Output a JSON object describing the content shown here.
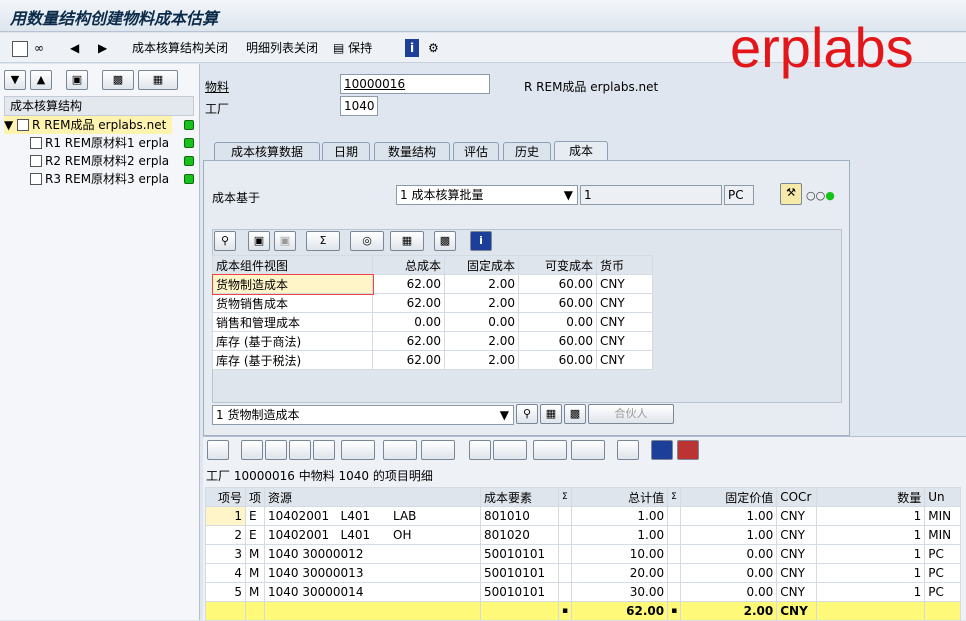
{
  "window": {
    "title": "用数量结构创建物料成本估算"
  },
  "brand": "erplabs",
  "toolbar": {
    "close_struct": "成本核算结构关闭",
    "close_detail": "明细列表关闭",
    "keep": "保持"
  },
  "tree": {
    "header": "成本核算结构",
    "items": [
      {
        "label": "R REM成品 erplabs.net"
      },
      {
        "label": "R1 REM原材料1 erpla"
      },
      {
        "label": "R2 REM原材料2 erpla"
      },
      {
        "label": "R3 REM原材料3 erpla"
      }
    ]
  },
  "header": {
    "material_label": "物料",
    "material_value": "10000016",
    "material_desc": "R REM成品 erplabs.net",
    "plant_label": "工厂",
    "plant_value": "1040"
  },
  "tabs": [
    "成本核算数据",
    "日期",
    "数量结构",
    "评估",
    "历史",
    "成本"
  ],
  "cost": {
    "basis_label": "成本基于",
    "basis_select": "1 成本核算批量",
    "qty": "1",
    "unit": "PC",
    "columns": [
      "成本组件视图",
      "总成本",
      "固定成本",
      "可变成本",
      "货币"
    ],
    "rows": [
      [
        "货物制造成本",
        "62.00",
        "2.00",
        "60.00",
        "CNY"
      ],
      [
        "货物销售成本",
        "62.00",
        "2.00",
        "60.00",
        "CNY"
      ],
      [
        "销售和管理成本",
        "0.00",
        "0.00",
        "0.00",
        "CNY"
      ],
      [
        "库存 (基于商法)",
        "62.00",
        "2.00",
        "60.00",
        "CNY"
      ],
      [
        "库存 (基于税法)",
        "62.00",
        "2.00",
        "60.00",
        "CNY"
      ]
    ],
    "view_select": "1 货物制造成本",
    "partner_btn": "合伙人"
  },
  "items": {
    "title": "工厂 10000016 中物料 1040 的项目明细",
    "columns": [
      "项号",
      "项",
      "资源",
      "成本要素",
      "Σ",
      "总计值",
      "Σ",
      "固定价值",
      "COCr",
      "数量",
      "Un"
    ],
    "rows": [
      [
        "1",
        "E",
        "10402001   L401      LAB",
        "801010",
        "",
        "1.00",
        "",
        "1.00",
        "CNY",
        "1",
        "MIN"
      ],
      [
        "2",
        "E",
        "10402001   L401      OH",
        "801020",
        "",
        "1.00",
        "",
        "1.00",
        "CNY",
        "1",
        "MIN"
      ],
      [
        "3",
        "M",
        "1040 30000012",
        "50010101",
        "",
        "10.00",
        "",
        "0.00",
        "CNY",
        "1",
        "PC"
      ],
      [
        "4",
        "M",
        "1040 30000013",
        "50010101",
        "",
        "20.00",
        "",
        "0.00",
        "CNY",
        "1",
        "PC"
      ],
      [
        "5",
        "M",
        "1040 30000014",
        "50010101",
        "",
        "30.00",
        "",
        "0.00",
        "CNY",
        "1",
        "PC"
      ]
    ],
    "total": [
      "",
      "",
      "",
      "",
      "▪",
      "62.00",
      "▪",
      "2.00",
      "CNY",
      "",
      ""
    ]
  },
  "colors": {
    "accent_green": "#17c31b",
    "total_yellow": "#fff97a",
    "brand_red": "#e3161a"
  }
}
